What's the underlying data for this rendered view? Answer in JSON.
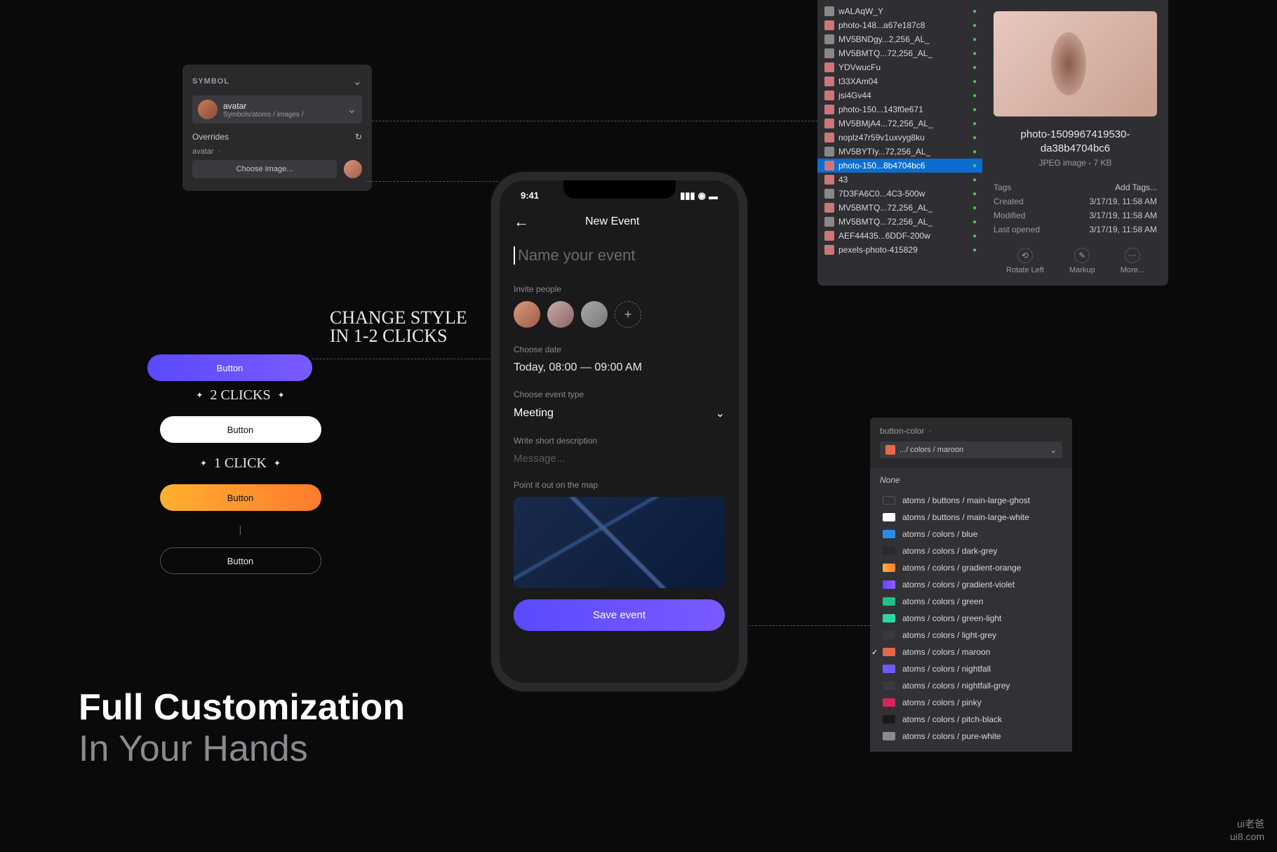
{
  "symbol_panel": {
    "header": "SYMBOL",
    "component_name": "avatar",
    "component_path": "Symbols/atoms / images /",
    "overrides_label": "Overrides",
    "avatar_label": "avatar",
    "choose_image": "Choose Image..."
  },
  "annotations": {
    "change_style": "CHANGE STYLE\nIN 1-2 CLICKS",
    "two_clicks": "2 CLICKS",
    "one_click": "1 CLICK"
  },
  "buttons": {
    "b1": "Button",
    "b2": "Button",
    "b3": "Button",
    "b4": "Button"
  },
  "phone": {
    "time": "9:41",
    "title": "New Event",
    "name_placeholder": "Name your event",
    "invite_label": "Invite people",
    "date_label": "Choose date",
    "date_value": "Today, 08:00 — 09:00 AM",
    "type_label": "Choose event type",
    "type_value": "Meeting",
    "desc_label": "Write short description",
    "desc_placeholder": "Message...",
    "map_label": "Point it out on the map",
    "save": "Save event"
  },
  "finder": {
    "files": [
      {
        "name": "wALAqW_Y",
        "icon": "txt"
      },
      {
        "name": "photo-148...a67e187c8",
        "icon": "img"
      },
      {
        "name": "MV5BNDgy...2,256_AL_",
        "icon": "txt"
      },
      {
        "name": "MV5BMTQ...72,256_AL_",
        "icon": "txt"
      },
      {
        "name": "YDVwucFu",
        "icon": "img"
      },
      {
        "name": "t33XAm04",
        "icon": "img"
      },
      {
        "name": "jsi4Gv44",
        "icon": "img"
      },
      {
        "name": "photo-150...143f0e671",
        "icon": "img"
      },
      {
        "name": "MV5BMjA4...72,256_AL_",
        "icon": "img"
      },
      {
        "name": "noplz47r59v1uxvyg8ku",
        "icon": "img"
      },
      {
        "name": "MV5BYTIy...72,256_AL_",
        "icon": "txt"
      },
      {
        "name": "photo-150...8b4704bc6",
        "icon": "img",
        "selected": true
      },
      {
        "name": "43",
        "icon": "img"
      },
      {
        "name": "7D3FA6C0...4C3-500w",
        "icon": "txt"
      },
      {
        "name": "MV5BMTQ...72,256_AL_",
        "icon": "img"
      },
      {
        "name": "MV5BMTQ...72,256_AL_",
        "icon": "txt"
      },
      {
        "name": "AEF44435...6DDF-200w",
        "icon": "img"
      },
      {
        "name": "pexels-photo-415829",
        "icon": "img"
      }
    ],
    "preview_name": "photo-1509967419530-da38b4704bc6",
    "preview_sub": "JPEG image - 7 KB",
    "meta": {
      "tags_k": "Tags",
      "tags_v": "Add Tags...",
      "created_k": "Created",
      "created_v": "3/17/19, 11:58 AM",
      "modified_k": "Modified",
      "modified_v": "3/17/19, 11:58 AM",
      "opened_k": "Last opened",
      "opened_v": "3/17/19, 11:58 AM"
    },
    "actions": {
      "rotate": "Rotate Left",
      "markup": "Markup",
      "more": "More..."
    }
  },
  "picker": {
    "label": "button-color",
    "selected": ".../ colors / maroon",
    "none": "None",
    "styles": [
      {
        "name": "atoms / buttons / main-large-ghost",
        "color": "transparent",
        "border": "1px solid #555"
      },
      {
        "name": "atoms / buttons / main-large-white",
        "color": "#ffffff"
      },
      {
        "name": "atoms / colors / blue",
        "color": "#2a8ae8"
      },
      {
        "name": "atoms / colors / dark-grey",
        "color": "#2a2a2e"
      },
      {
        "name": "atoms / colors / gradient-orange",
        "color": "linear-gradient(90deg,#ffb02e,#ff7a2e)"
      },
      {
        "name": "atoms / colors / gradient-violet",
        "color": "linear-gradient(90deg,#5a4aff,#9a5aff)"
      },
      {
        "name": "atoms / colors / green",
        "color": "#1fc08a"
      },
      {
        "name": "atoms / colors / green-light",
        "color": "#2ad8a0"
      },
      {
        "name": "atoms / colors / light-grey",
        "color": "#3a3a3e"
      },
      {
        "name": "atoms / colors / maroon",
        "color": "#e8664a",
        "checked": true
      },
      {
        "name": "atoms / colors / nightfall",
        "color": "#6a5aff"
      },
      {
        "name": "atoms / colors / nightfall-grey",
        "color": "#3a3a42"
      },
      {
        "name": "atoms / colors / pinky",
        "color": "#d8245a"
      },
      {
        "name": "atoms / colors / pitch-black",
        "color": "#1a1a1c"
      },
      {
        "name": "atoms / colors / pure-white",
        "color": "#8a8a90"
      }
    ]
  },
  "headline": {
    "l1": "Full Customization",
    "l2": "In Your Hands"
  },
  "watermark": {
    "l1": "ui老爸",
    "l2": "ui8.com"
  }
}
